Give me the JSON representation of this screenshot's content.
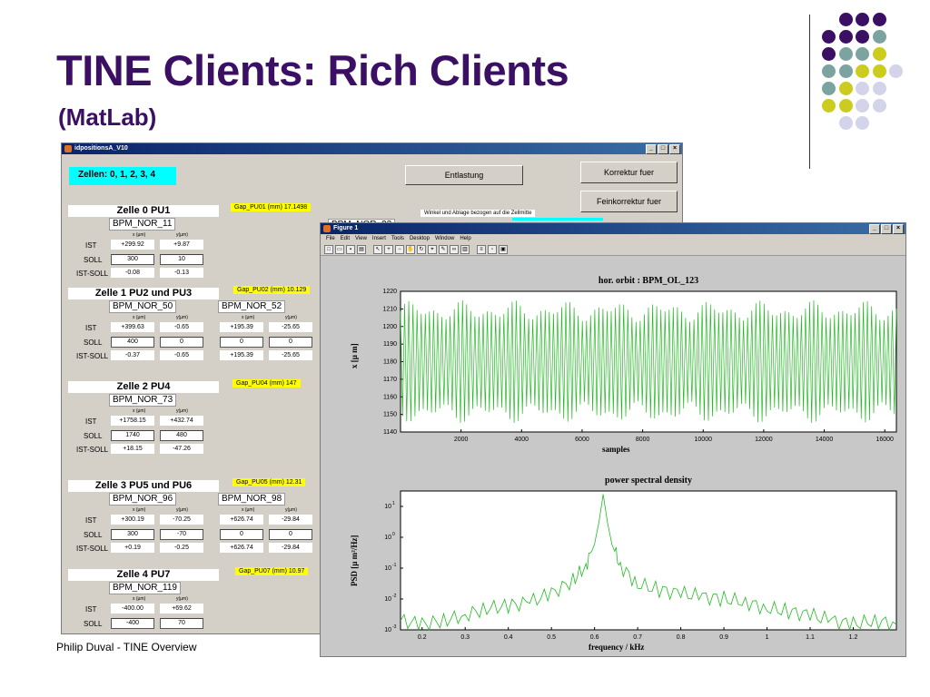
{
  "slide": {
    "title": "TINE Clients: Rich Clients",
    "subtitle": "(MatLab)",
    "footer": "Philip Duval - TINE Overview"
  },
  "colors": {
    "purple": "#3b0f64",
    "teal": "#7ba3a0",
    "olive": "#cccc1e",
    "lavender": "#d3d3ea"
  },
  "gui": {
    "window_title": "idpositionsA_V10",
    "zellen": "Zellen: 0, 1, 2, 3, 4",
    "entlastung": "Entlastung",
    "korrektur": "Korrektur fuer",
    "feinkorrektur": "Feinkorrektur fuer",
    "winkel_note": "Winkel und Ablage bezogen auf die Zellmitte",
    "hidden_bpm": "BPM_NOR_23",
    "row_labels": {
      "ist": "IST",
      "soll": "SOLL",
      "ist_soll": "IST-SOLL"
    },
    "unit_x": "x (µm)",
    "unit_y": "y(µm)",
    "cells": [
      {
        "title": "Zelle 0 PU1",
        "gap": "Gap_PU01 (mm) 17.1498",
        "bpms": [
          {
            "name": "BPM_NOR_11",
            "ist": [
              "+299.92",
              "+9.87"
            ],
            "soll": [
              "300",
              "10"
            ],
            "diff": [
              "-0.08",
              "-0.13"
            ]
          }
        ]
      },
      {
        "title": "Zelle 1 PU2 und PU3",
        "gap": "Gap_PU02 (mm) 10.129",
        "bpms": [
          {
            "name": "BPM_NOR_50",
            "ist": [
              "+399.63",
              "-0.65"
            ],
            "soll": [
              "400",
              "0"
            ],
            "diff": [
              "-0.37",
              "-0.65"
            ]
          },
          {
            "name": "BPM_NOR_52",
            "ist": [
              "+195.39",
              "-25.65"
            ],
            "soll": [
              "0",
              "0"
            ],
            "diff": [
              "+195.39",
              "-25.65"
            ]
          }
        ]
      },
      {
        "title": "Zelle 2 PU4",
        "gap": "Gap_PU04 (mm) 147",
        "bpms": [
          {
            "name": "BPM_NOR_73",
            "ist": [
              "+1758.15",
              "+432.74"
            ],
            "soll": [
              "1740",
              "480"
            ],
            "diff": [
              "+18.15",
              "-47.26"
            ]
          }
        ]
      },
      {
        "title": "Zelle 3 PU5 und PU6",
        "gap": "Gap_PU05 (mm) 12.31",
        "bpms": [
          {
            "name": "BPM_NOR_96",
            "ist": [
              "+300.19",
              "-70.25"
            ],
            "soll": [
              "300",
              "-70"
            ],
            "diff": [
              "+0.19",
              "-0.25"
            ]
          },
          {
            "name": "BPM_NOR_98",
            "ist": [
              "+626.74",
              "-29.84"
            ],
            "soll": [
              "0",
              "0"
            ],
            "diff": [
              "+626.74",
              "-29.84"
            ]
          }
        ]
      },
      {
        "title": "Zelle 4 PU7",
        "gap": "Gap_PU07 (mm) 10.97",
        "bpms": [
          {
            "name": "BPM_NOR_119",
            "ist": [
              "-400.00",
              "+69.62"
            ],
            "soll": [
              "-400",
              "70"
            ],
            "diff": [
              "",
              ""
            ]
          }
        ]
      }
    ]
  },
  "figure": {
    "window_title": "Figure 1",
    "menu": [
      "File",
      "Edit",
      "View",
      "Insert",
      "Tools",
      "Desktop",
      "Window",
      "Help"
    ],
    "toolbar_icons": [
      "new-icon",
      "open-icon",
      "save-icon",
      "print-icon",
      "arrow-icon",
      "zoom-in-icon",
      "zoom-out-icon",
      "pan-icon",
      "rotate-icon",
      "datacursor-icon",
      "brush-icon",
      "link-icon",
      "colorbar-icon",
      "legend-icon",
      "hide-tools-icon",
      "show-tools-icon"
    ],
    "plot1": {
      "title": "hor. orbit : BPM_OL_123",
      "xlabel": "samples",
      "ylabel": "x [µ m]"
    },
    "plot2": {
      "title": "power spectral density",
      "xlabel": "frequency / kHz",
      "ylabel": "PSD [µ m²/Hz]"
    }
  },
  "chart_data": [
    {
      "type": "line",
      "title": "hor. orbit : BPM_OL_123",
      "xlabel": "samples",
      "ylabel": "x [µ m]",
      "xlim": [
        0,
        16384
      ],
      "ylim": [
        1140,
        1220
      ],
      "xticks": [
        2000,
        4000,
        6000,
        8000,
        10000,
        12000,
        14000,
        16000
      ],
      "yticks": [
        1140,
        1150,
        1160,
        1170,
        1180,
        1190,
        1200,
        1210,
        1220
      ],
      "color": "#22bb22",
      "description_values": {
        "oscillation_min": 1145,
        "oscillation_max": 1215,
        "cycles": 120
      }
    },
    {
      "type": "line",
      "title": "power spectral density",
      "xlabel": "frequency / kHz",
      "ylabel": "PSD [µ m²/Hz]",
      "xlim": [
        0.15,
        1.3
      ],
      "ylim_log10": [
        -3,
        1.5
      ],
      "yscale": "log",
      "xticks": [
        0.2,
        0.3,
        0.4,
        0.5,
        0.6,
        0.7,
        0.8,
        0.9,
        1,
        1.1,
        1.2
      ],
      "xtick_labels": [
        "0.2",
        "0.3",
        "0.4",
        "0.5",
        "0.6",
        "0.7",
        "0.8",
        "0.9",
        "1",
        "1.1",
        "1.2"
      ],
      "yticks_log10": [
        -3,
        -2,
        -1,
        0,
        1
      ],
      "ytick_labels": [
        "10",
        "10",
        "10",
        "10",
        "10"
      ],
      "ytick_exponents": [
        "-3",
        "-2",
        "-1",
        "0",
        "1"
      ],
      "color": "#22bb22",
      "x": [
        0.15,
        0.2,
        0.25,
        0.3,
        0.35,
        0.4,
        0.45,
        0.5,
        0.55,
        0.58,
        0.6,
        0.61,
        0.62,
        0.63,
        0.64,
        0.66,
        0.7,
        0.75,
        0.8,
        0.85,
        0.9,
        0.95,
        1.0,
        1.05,
        1.1,
        1.15,
        1.2,
        1.25,
        1.3
      ],
      "y": [
        0.002,
        0.0015,
        0.002,
        0.003,
        0.005,
        0.006,
        0.008,
        0.015,
        0.04,
        0.12,
        0.6,
        3,
        25,
        3,
        0.6,
        0.12,
        0.03,
        0.02,
        0.015,
        0.012,
        0.01,
        0.008,
        0.005,
        0.004,
        0.003,
        0.002,
        0.0015,
        0.002,
        0.0015
      ]
    }
  ]
}
